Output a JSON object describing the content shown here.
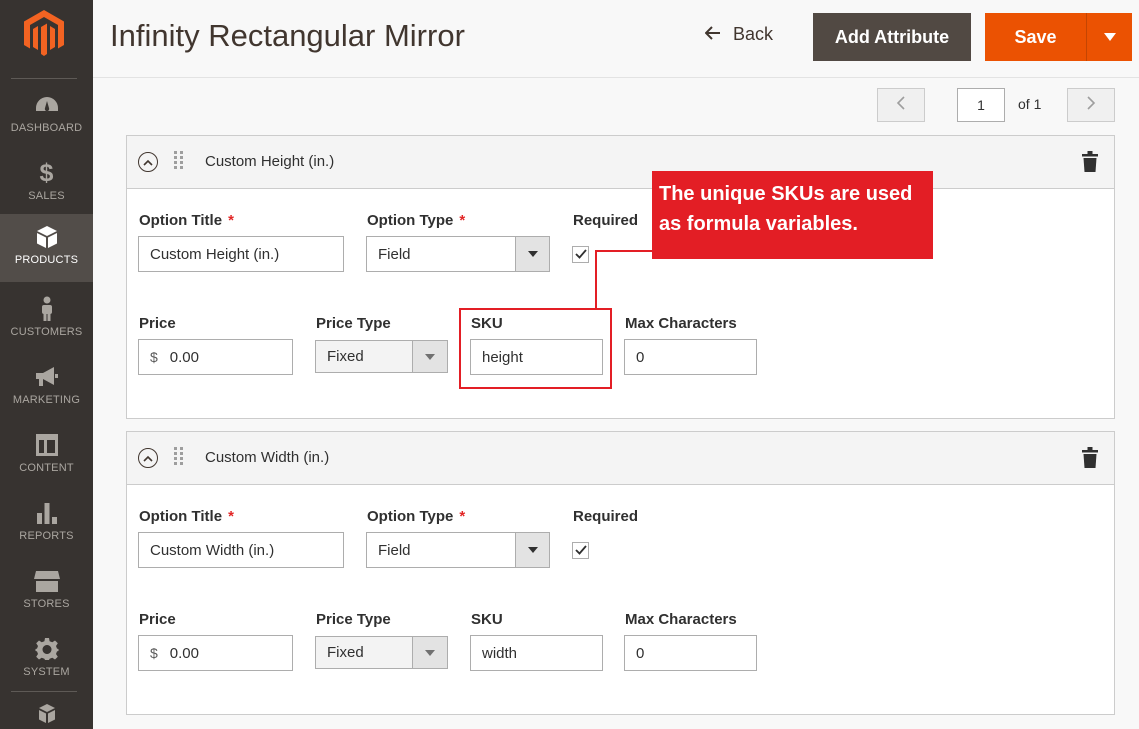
{
  "sidebar": {
    "logo_icon": "magento-logo-icon",
    "items": [
      {
        "label": "DASHBOARD",
        "icon": "gauge-icon"
      },
      {
        "label": "SALES",
        "icon": "dollar-icon"
      },
      {
        "label": "PRODUCTS",
        "icon": "cube-icon",
        "active": true
      },
      {
        "label": "CUSTOMERS",
        "icon": "person-icon"
      },
      {
        "label": "MARKETING",
        "icon": "megaphone-icon"
      },
      {
        "label": "CONTENT",
        "icon": "layout-icon"
      },
      {
        "label": "REPORTS",
        "icon": "bar-chart-icon"
      },
      {
        "label": "STORES",
        "icon": "storefront-icon"
      },
      {
        "label": "SYSTEM",
        "icon": "gear-icon"
      }
    ]
  },
  "header": {
    "title": "Infinity Rectangular Mirror",
    "back_label": "Back",
    "add_attribute_label": "Add Attribute",
    "save_label": "Save"
  },
  "pager": {
    "current": "1",
    "of_label": "of 1"
  },
  "options": [
    {
      "title": "Custom Height (in.)",
      "labels": {
        "option_title": "Option Title",
        "option_type": "Option Type",
        "required": "Required",
        "price": "Price",
        "price_type": "Price Type",
        "sku": "SKU",
        "max_characters": "Max Characters"
      },
      "option_title_value": "Custom Height (in.)",
      "option_type_value": "Field",
      "required_checked": true,
      "currency_symbol": "$",
      "price_value": "0.00",
      "price_type_value": "Fixed",
      "sku_value": "height",
      "max_characters_value": "0"
    },
    {
      "title": "Custom Width (in.)",
      "labels": {
        "option_title": "Option Title",
        "option_type": "Option Type",
        "required": "Required",
        "price": "Price",
        "price_type": "Price Type",
        "sku": "SKU",
        "max_characters": "Max Characters"
      },
      "option_title_value": "Custom Width (in.)",
      "option_type_value": "Field",
      "required_checked": true,
      "currency_symbol": "$",
      "price_value": "0.00",
      "price_type_value": "Fixed",
      "sku_value": "width",
      "max_characters_value": "0"
    }
  ],
  "callout": {
    "line1": "The unique SKUs are used",
    "line2": "as formula variables."
  },
  "colors": {
    "sidebar_bg": "#373330",
    "sidebar_active": "#524d49",
    "save_orange": "#eb5202",
    "add_attr_bg": "#514943",
    "callout_red": "#e31e25",
    "required_star": "#e22626"
  }
}
